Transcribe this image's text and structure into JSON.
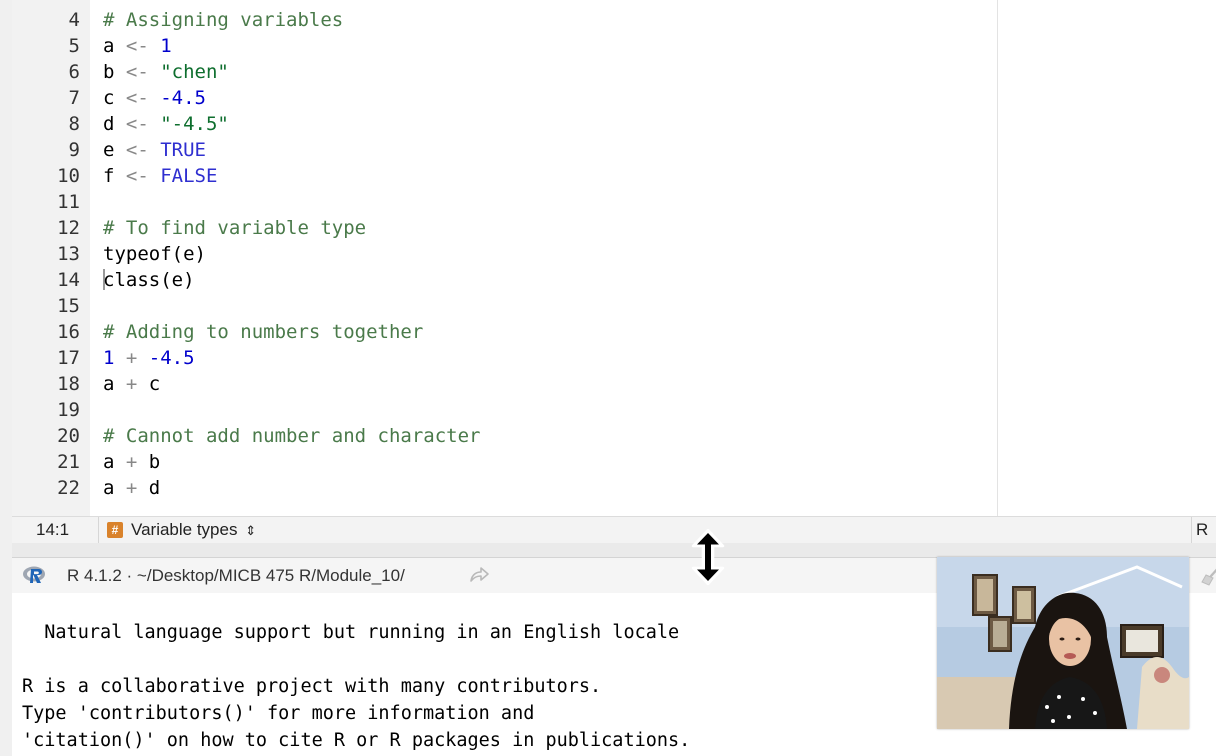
{
  "editor": {
    "lines": [
      {
        "n": "4",
        "tokens": [
          {
            "t": "# Assigning variables",
            "c": "comment"
          }
        ]
      },
      {
        "n": "5",
        "tokens": [
          {
            "t": "a",
            "c": "id"
          },
          {
            "t": " <- ",
            "c": "op"
          },
          {
            "t": "1",
            "c": "num"
          }
        ]
      },
      {
        "n": "6",
        "tokens": [
          {
            "t": "b",
            "c": "id"
          },
          {
            "t": " <- ",
            "c": "op"
          },
          {
            "t": "\"chen\"",
            "c": "str"
          }
        ]
      },
      {
        "n": "7",
        "tokens": [
          {
            "t": "c",
            "c": "id"
          },
          {
            "t": " <- ",
            "c": "op"
          },
          {
            "t": "-4.5",
            "c": "num"
          }
        ]
      },
      {
        "n": "8",
        "tokens": [
          {
            "t": "d",
            "c": "id"
          },
          {
            "t": " <- ",
            "c": "op"
          },
          {
            "t": "\"-4.5\"",
            "c": "str"
          }
        ]
      },
      {
        "n": "9",
        "tokens": [
          {
            "t": "e",
            "c": "id"
          },
          {
            "t": " <- ",
            "c": "op"
          },
          {
            "t": "TRUE",
            "c": "kw"
          }
        ]
      },
      {
        "n": "10",
        "tokens": [
          {
            "t": "f",
            "c": "id"
          },
          {
            "t": " <- ",
            "c": "op"
          },
          {
            "t": "FALSE",
            "c": "kw"
          }
        ]
      },
      {
        "n": "11",
        "tokens": []
      },
      {
        "n": "12",
        "tokens": [
          {
            "t": "# To find variable type",
            "c": "comment"
          }
        ]
      },
      {
        "n": "13",
        "tokens": [
          {
            "t": "typeof(e)",
            "c": "fn"
          }
        ]
      },
      {
        "n": "14",
        "tokens": [
          {
            "t": "class(e)",
            "c": "fn"
          }
        ],
        "cursor": true
      },
      {
        "n": "15",
        "tokens": []
      },
      {
        "n": "16",
        "tokens": [
          {
            "t": "# Adding to numbers together",
            "c": "comment"
          }
        ]
      },
      {
        "n": "17",
        "tokens": [
          {
            "t": "1",
            "c": "num"
          },
          {
            "t": " + ",
            "c": "op"
          },
          {
            "t": "-4.5",
            "c": "num"
          }
        ]
      },
      {
        "n": "18",
        "tokens": [
          {
            "t": "a",
            "c": "id"
          },
          {
            "t": " + ",
            "c": "op"
          },
          {
            "t": "c",
            "c": "id"
          }
        ]
      },
      {
        "n": "19",
        "tokens": []
      },
      {
        "n": "20",
        "tokens": [
          {
            "t": "# Cannot add number and character",
            "c": "comment"
          }
        ]
      },
      {
        "n": "21",
        "tokens": [
          {
            "t": "a",
            "c": "id"
          },
          {
            "t": " + ",
            "c": "op"
          },
          {
            "t": "b",
            "c": "id"
          }
        ]
      },
      {
        "n": "22",
        "tokens": [
          {
            "t": "a",
            "c": "id"
          },
          {
            "t": " + ",
            "c": "op"
          },
          {
            "t": "d",
            "c": "id"
          }
        ]
      }
    ]
  },
  "statusbar": {
    "position": "14:1",
    "section_icon": "section-hash-icon",
    "section": "Variable types",
    "section_dropdown": "⇕",
    "language": "R"
  },
  "console_header": {
    "logo_icon": "r-logo-icon",
    "title": "R 4.1.2 · ~/Desktop/MICB 475 R/Module_10/",
    "share_icon": "go-to-directory-icon",
    "clear_icon": "broom-icon"
  },
  "console": {
    "lines": [
      "  Natural language support but running in an English locale",
      "",
      "R is a collaborative project with many contributors.",
      "Type 'contributors()' for more information and",
      "'citation()' on how to cite R or R packages in publications."
    ]
  },
  "overlay": {
    "resize_icon": "vertical-resize-cursor-icon",
    "webcam": "presenter-webcam"
  }
}
